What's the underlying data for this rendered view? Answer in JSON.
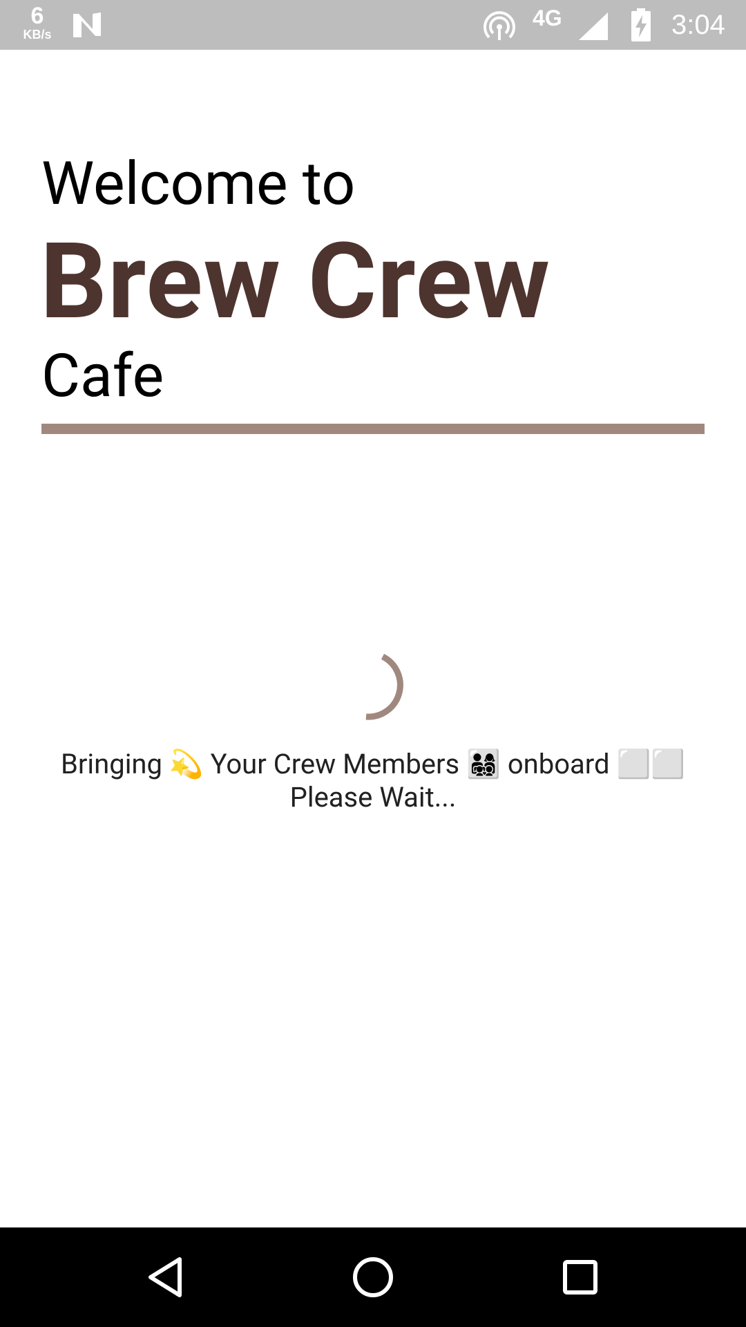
{
  "status_bar": {
    "speed_value": "6",
    "speed_unit": "KB/s",
    "network_type": "4G",
    "time": "3:04",
    "icons": [
      "n-notification-icon",
      "hotspot-icon",
      "cell-signal-icon",
      "battery-charging-icon"
    ]
  },
  "header": {
    "welcome": "Welcome to",
    "brand": "Brew Crew",
    "subtitle": "Cafe",
    "brand_color": "#4e342e",
    "divider_color": "#a1887f"
  },
  "loading": {
    "line1": "Bringing 💫 Your Crew Members 👨‍👩‍👧‍👦 onboard ⬜⬜",
    "line2": "Please Wait...",
    "spinner_color": "#a1887f"
  },
  "nav_bar": {
    "buttons": [
      "back-icon",
      "home-icon",
      "recents-icon"
    ]
  }
}
